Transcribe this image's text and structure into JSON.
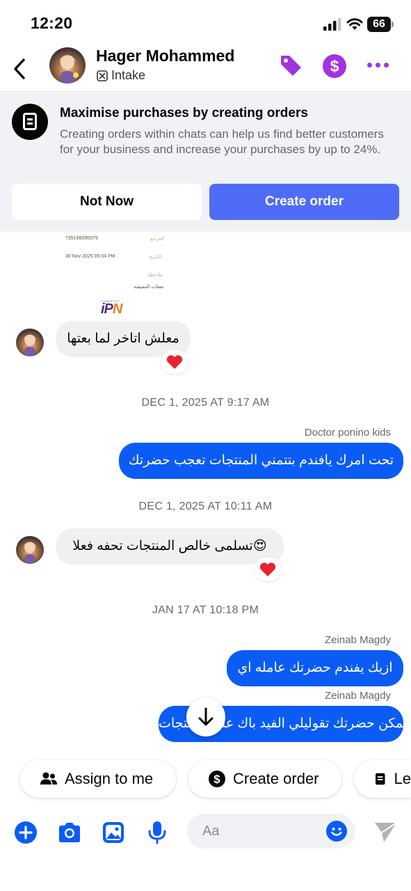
{
  "status_bar": {
    "time": "12:20",
    "battery": "66",
    "signal_icon": "cellular-signal-icon",
    "wifi_icon": "wifi-icon"
  },
  "header": {
    "contact_name": "Hager Mohammed",
    "contact_label": "Intake",
    "back_icon": "chevron-left-icon",
    "tag_icon": "tag-icon",
    "dollar_icon": "dollar-icon",
    "dollar_symbol": "$",
    "more_icon": "more-icon",
    "accent_color": "#a233e0"
  },
  "promo": {
    "title": "Maximise purchases by creating orders",
    "body": "Creating orders within chats can help us find better customers for your business and increase your purchases by up to 24%.",
    "not_now_label": "Not Now",
    "create_order_label": "Create order",
    "primary_color": "#4f6cf7"
  },
  "receipt": {
    "reference_value": "735198200079",
    "reference_label": "المرجع",
    "date_value": "30 Nov 2025 05:04 PM",
    "date_label": "التاريخ",
    "note_label": "ملاحظة",
    "note_value": "نفقات المعيشة",
    "powered_by": "POWERED BY",
    "logo_text_main": "iP",
    "logo_text_accent": "N"
  },
  "messages": [
    {
      "direction": "incoming",
      "text": "معلش اتاخر لما بعتها",
      "reaction": "❤️"
    },
    {
      "type": "timestamp",
      "text": "DEC 1, 2025 AT 9:17 AM"
    },
    {
      "direction": "outgoing",
      "sender": "Doctor ponino kids",
      "text": "تحت امرك يافندم بتتمني المنتجات تعجب حضرتك"
    },
    {
      "type": "timestamp",
      "text": "DEC 1, 2025 AT 10:11 AM"
    },
    {
      "direction": "incoming",
      "text": "تسلمى خالص  المنتجات تحفه فعلا😍",
      "reaction": "❤️"
    },
    {
      "type": "timestamp",
      "text": "JAN 17 AT 10:18 PM"
    },
    {
      "direction": "outgoing",
      "sender": "Zeinab Magdy",
      "text": "ازيك يفندم حضرتك عامله اي"
    },
    {
      "direction": "outgoing",
      "sender": "Zeinab Magdy",
      "text": "ممكن حضرتك تقوليلي الفيد باك على المنتجات"
    }
  ],
  "bubble_colors": {
    "outgoing": "#0a5cf5",
    "incoming": "#f0f0f0"
  },
  "quick_actions": [
    {
      "label": "Assign to me",
      "icon": "people-icon"
    },
    {
      "label": "Create order",
      "icon": "dollar-circle-icon"
    },
    {
      "label": "Le",
      "icon": "document-icon"
    }
  ],
  "composer": {
    "placeholder": "Aa",
    "icons": [
      "plus-icon",
      "camera-icon",
      "gallery-icon",
      "microphone-icon",
      "emoji-icon",
      "send-icon"
    ]
  }
}
